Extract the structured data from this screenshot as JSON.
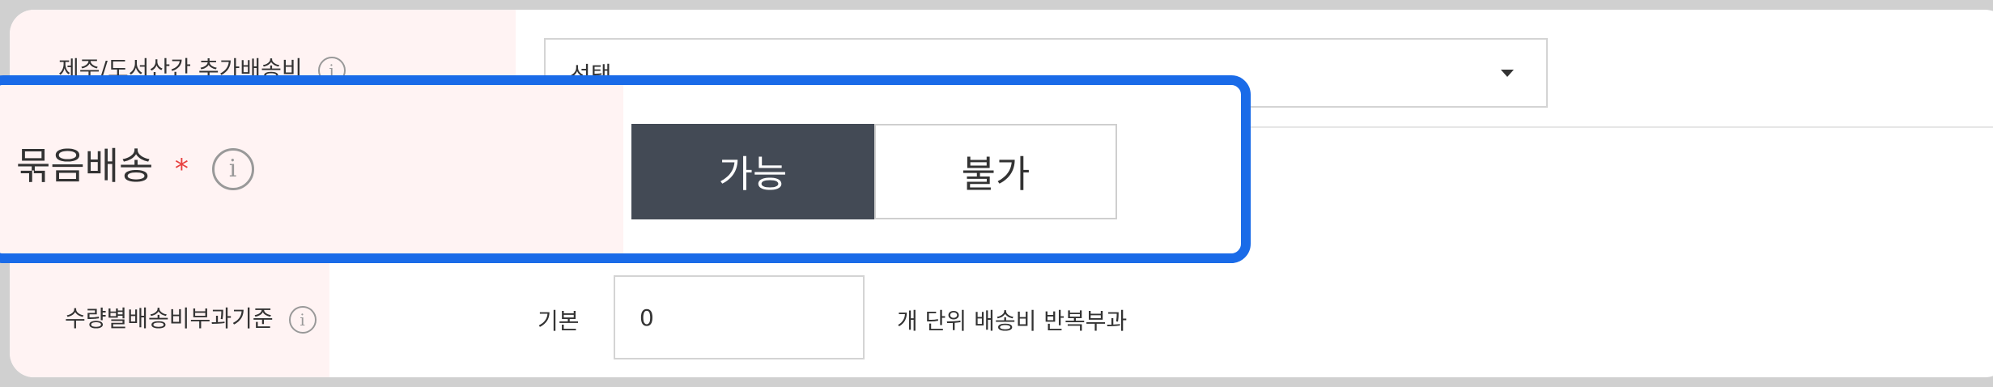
{
  "row_island_fee": {
    "label": "제주/도서산간 추가배송비",
    "info": "i",
    "select_value": "선택"
  },
  "row_bundle": {
    "label": "묶음배송",
    "required_mark": "*",
    "info": "i",
    "option_yes": "가능",
    "option_no": "불가",
    "selected": "가능"
  },
  "row_quantity": {
    "label": "수량별배송비부과기준",
    "info": "i",
    "basic_label": "기본",
    "quantity_value": "0",
    "unit_text": "개 단위 배송비 반복부과"
  },
  "colors": {
    "highlight_border": "#1a6be8",
    "toggle_active_bg": "#434a55",
    "required": "#e8413f",
    "label_bg": "#fff3f3"
  }
}
